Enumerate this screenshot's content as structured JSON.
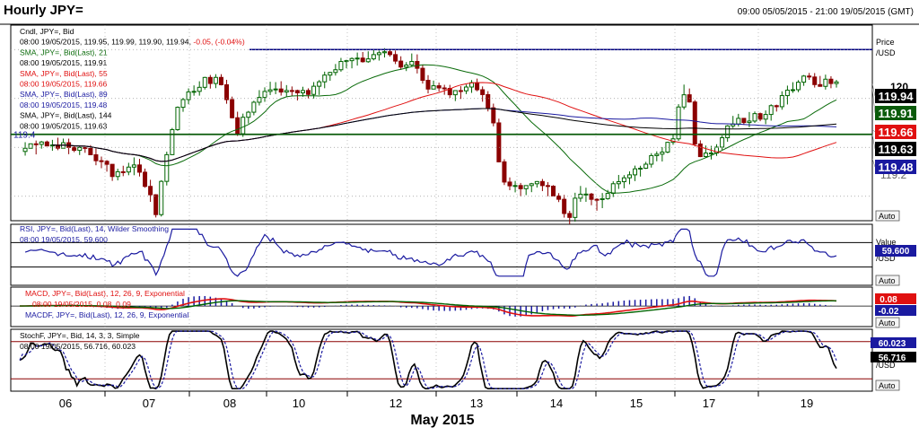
{
  "header": {
    "title": "Hourly JPY=",
    "range": "09:00 05/05/2015 - 21:00 19/05/2015 (GMT)"
  },
  "colors": {
    "candle_up": "#006400",
    "candle_down": "#8b0000",
    "sma21": "#0a6b0a",
    "sma55": "#e01010",
    "sma89": "#1a1aa0",
    "sma144": "#000000",
    "rsi": "#1a1aa0",
    "macd": "#e01010",
    "signal": "#006400",
    "hist": "#1a1aa0",
    "stoch_k": "#000000",
    "stoch_d": "#1a1aa0",
    "navy_line": "#000080",
    "green_line": "#0a5a0a"
  },
  "price_panel": {
    "legend": [
      {
        "text": "Cndl, JPY=, Bid",
        "color": "#000000"
      },
      {
        "text": "08:00 19/05/2015, 119.95, 119.99, 119.90, 119.94, -0.05, (-0.04%)",
        "color": "#000000",
        "parts": [
          "08:00 19/05/2015, 119.95, 119.99, 119.90, 119.94, ",
          "-0.05, (-0.04%)"
        ]
      },
      {
        "text": "SMA, JPY=, Bid(Last), 21",
        "color": "#0a6b0a"
      },
      {
        "text": "08:00 19/05/2015, 119.91",
        "color": "#000000"
      },
      {
        "text": "SMA, JPY=, Bid(Last), 55",
        "color": "#e01010"
      },
      {
        "text": "08:00 19/05/2015, 119.66",
        "color": "#e01010"
      },
      {
        "text": "SMA, JPY=, Bid(Last), 89",
        "color": "#1a1aa0"
      },
      {
        "text": "08:00 19/05/2015, 119.48",
        "color": "#1a1aa0"
      },
      {
        "text": "SMA, JPY=, Bid(Last), 144",
        "color": "#000000"
      },
      {
        "text": "08:00 19/05/2015, 119.63",
        "color": "#000000"
      }
    ],
    "axis_title": "Price",
    "axis_unit": "/USD",
    "support_label": "119.4",
    "hidden_tick": "119.2",
    "visible_tick": "120",
    "auto": "Auto",
    "badges": [
      {
        "text": "119.94",
        "bg": "#000000",
        "fg": "#ffffff",
        "value": 119.94
      },
      {
        "text": "119.91",
        "bg": "#0a5a0a",
        "fg": "#ffffff",
        "value": 119.91
      },
      {
        "text": "119.66",
        "bg": "#e01010",
        "fg": "#ffffff",
        "value": 119.66
      },
      {
        "text": "119.63",
        "bg": "#000000",
        "fg": "#ffffff",
        "value": 119.63
      },
      {
        "text": "119.48",
        "bg": "#1a1aa0",
        "fg": "#ffffff",
        "value": 119.48
      }
    ]
  },
  "rsi_panel": {
    "legend": [
      {
        "text": "RSI, JPY=, Bid(Last), 14, Wilder Smoothing",
        "color": "#1a1aa0"
      },
      {
        "text": "08:00 19/05/2015, 59.600",
        "color": "#1a1aa0"
      }
    ],
    "axis_title": "Value",
    "axis_unit": "/USD",
    "badge": {
      "text": "59.600",
      "bg": "#1a1aa0",
      "fg": "#ffffff"
    },
    "auto": "Auto"
  },
  "macd_panel": {
    "legend": [
      {
        "text": "MACD, JPY=, Bid(Last), 12, 26, 9, Exponential",
        "color": "#e01010"
      },
      {
        "text": "08:00 19/05/2015, 0.08, 0.09",
        "color": "#e01010"
      },
      {
        "text": "MACDF, JPY=, Bid(Last), 12, 26, 9, Exponential",
        "color": "#1a1aa0"
      }
    ],
    "axis_unit": "/USD",
    "badges": [
      {
        "text": "0.08",
        "bg": "#e01010",
        "fg": "#ffffff"
      },
      {
        "text": "-0.02",
        "bg": "#1a1aa0",
        "fg": "#ffffff"
      }
    ],
    "auto": "Auto"
  },
  "stoch_panel": {
    "legend": [
      {
        "text": "StochF, JPY=, Bid, 14, 3, 3, Simple",
        "color": "#000000"
      },
      {
        "text": "08:00 19/05/2015, 56.716, 60.023",
        "color": "#000000"
      }
    ],
    "axis_unit": "/USD",
    "badges": [
      {
        "text": "60.023",
        "bg": "#1a1aa0",
        "fg": "#ffffff"
      },
      {
        "text": "56.716",
        "bg": "#000000",
        "fg": "#ffffff"
      }
    ],
    "auto": "Auto"
  },
  "x_axis": {
    "ticks": [
      "06",
      "07",
      "08",
      "10",
      "12",
      "13",
      "14",
      "15",
      "17",
      "19"
    ],
    "month_label": "May 2015"
  },
  "chart_data": {
    "type": "candlestick",
    "title": "Hourly JPY=",
    "x_range": [
      "09:00 05/05/2015",
      "21:00 19/05/2015"
    ],
    "price_ylim": [
      119.1,
      120.3
    ],
    "horizontal_levels": [
      {
        "value": 120.15,
        "color": "#000080"
      },
      {
        "value": 119.63,
        "color": "#0a5a0a"
      }
    ],
    "anchors": [
      [
        0,
        119.55
      ],
      [
        40,
        119.57
      ],
      [
        80,
        119.51
      ],
      [
        105,
        119.38
      ],
      [
        130,
        119.45
      ],
      [
        150,
        119.15
      ],
      [
        165,
        119.58
      ],
      [
        175,
        119.82
      ],
      [
        200,
        119.95
      ],
      [
        220,
        119.98
      ],
      [
        240,
        119.65
      ],
      [
        260,
        119.85
      ],
      [
        280,
        119.92
      ],
      [
        300,
        119.88
      ],
      [
        320,
        119.88
      ],
      [
        350,
        120.05
      ],
      [
        380,
        120.1
      ],
      [
        400,
        120.14
      ],
      [
        420,
        120.05
      ],
      [
        430,
        120.1
      ],
      [
        450,
        119.92
      ],
      [
        480,
        119.88
      ],
      [
        500,
        119.93
      ],
      [
        520,
        119.78
      ],
      [
        532,
        119.33
      ],
      [
        550,
        119.28
      ],
      [
        570,
        119.33
      ],
      [
        590,
        119.26
      ],
      [
        605,
        119.1
      ],
      [
        615,
        119.3
      ],
      [
        635,
        119.2
      ],
      [
        650,
        119.3
      ],
      [
        680,
        119.4
      ],
      [
        700,
        119.5
      ],
      [
        720,
        119.6
      ],
      [
        730,
        119.9
      ],
      [
        737,
        119.85
      ],
      [
        745,
        119.52
      ],
      [
        760,
        119.51
      ],
      [
        775,
        119.6
      ],
      [
        780,
        119.7
      ],
      [
        800,
        119.73
      ],
      [
        820,
        119.74
      ],
      [
        840,
        119.85
      ],
      [
        860,
        119.98
      ],
      [
        880,
        119.95
      ],
      [
        900,
        119.94
      ]
    ],
    "sma_series": [
      {
        "name": "SMA 21",
        "period": 21,
        "last": 119.91
      },
      {
        "name": "SMA 55",
        "period": 55,
        "last": 119.66
      },
      {
        "name": "SMA 89",
        "period": 89,
        "last": 119.48
      },
      {
        "name": "SMA 144",
        "period": 144,
        "last": 119.63
      }
    ],
    "rsi": {
      "period": 14,
      "last": 59.6,
      "ylim": [
        0,
        100
      ],
      "levels": [
        70,
        30
      ]
    },
    "macd": {
      "fast": 12,
      "slow": 26,
      "signal": 9,
      "macd_last": 0.08,
      "signal_last": 0.09,
      "histogram_last": -0.02
    },
    "stochastic": {
      "k_last": 56.716,
      "d_last": 60.023,
      "ylim": [
        0,
        100
      ],
      "levels": [
        80,
        20
      ]
    }
  }
}
